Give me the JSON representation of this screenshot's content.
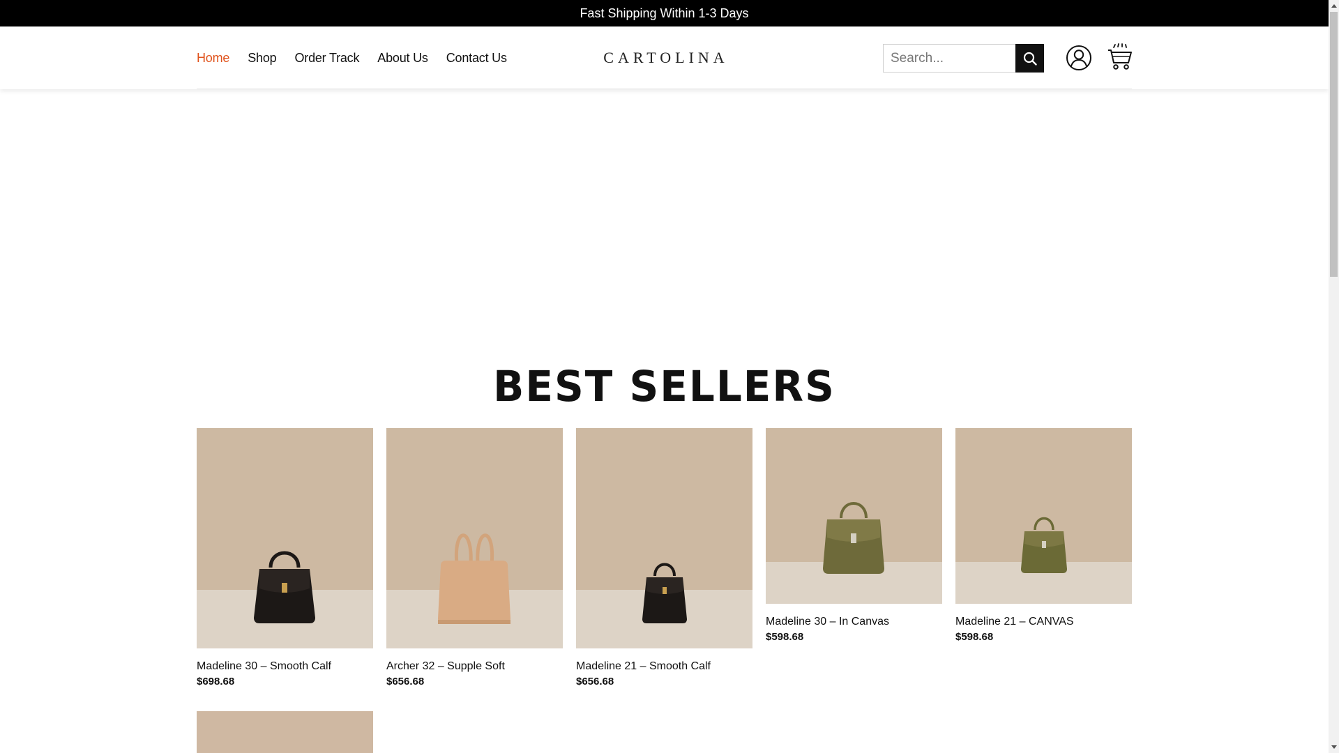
{
  "announcement": "Fast Shipping Within 1-3 Days",
  "nav": {
    "items": [
      {
        "label": "Home",
        "active": true
      },
      {
        "label": "Shop"
      },
      {
        "label": "Order Track"
      },
      {
        "label": "About Us"
      },
      {
        "label": "Contact Us"
      }
    ]
  },
  "logo": "CARTOLINA",
  "search": {
    "placeholder": "Search...",
    "value": ""
  },
  "section_title": "BEST SELLERS",
  "products": [
    {
      "name": "Madeline 30 – Smooth Calf",
      "price": "$698.68",
      "bag_color": "#1c1816"
    },
    {
      "name": "Archer 32 – Supple Soft",
      "price": "$656.68",
      "bag_color": "#d9ab84"
    },
    {
      "name": "Madeline 21 – Smooth Calf",
      "price": "$656.68",
      "bag_color": "#1c1816"
    },
    {
      "name": "Madeline 30 – In Canvas",
      "price": "$598.68",
      "bag_color": "#6e6a3a"
    },
    {
      "name": "Madeline 21 – CANVAS",
      "price": "$598.68",
      "bag_color": "#6b6a36"
    }
  ],
  "colors": {
    "accent": "#e0521b",
    "topbar": "#000000",
    "wall": "#cdb9a2",
    "table": "#ddd3c6"
  },
  "icons": [
    "search-icon",
    "account-icon",
    "cart-icon"
  ]
}
